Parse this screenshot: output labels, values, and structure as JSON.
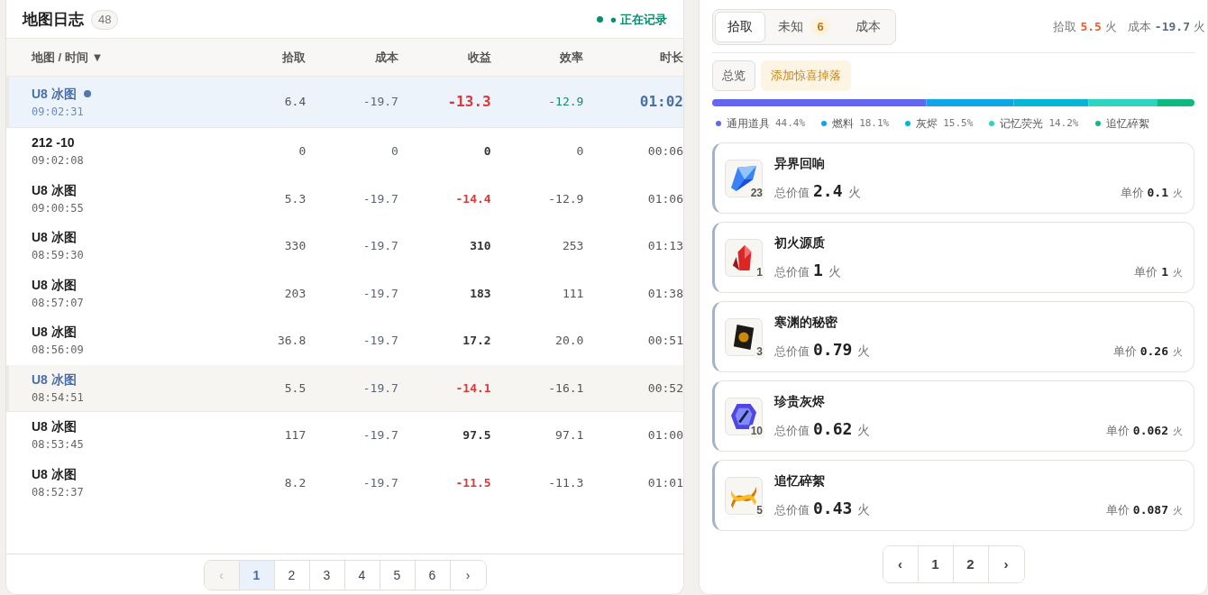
{
  "log": {
    "title": "地图日志",
    "count": "48",
    "status": "● 正在记录",
    "columns": [
      "地图 / 时间 ▼",
      "拾取",
      "成本",
      "收益",
      "效率",
      "时长"
    ],
    "rows": [
      {
        "map": "U8 冰图",
        "time": "09:02:31",
        "pickup": "6.4",
        "cost": "-19.7",
        "profit": "-13.3",
        "efficiency": "-12.9",
        "duration": "01:02",
        "selected": true,
        "highlighted": false,
        "live": true,
        "loss": true
      },
      {
        "map": "212 -10",
        "time": "09:02:08",
        "pickup": "0",
        "cost": "0",
        "profit": "0",
        "efficiency": "0",
        "duration": "00:06",
        "selected": false,
        "highlighted": false,
        "live": false,
        "loss": false
      },
      {
        "map": "U8 冰图",
        "time": "09:00:55",
        "pickup": "5.3",
        "cost": "-19.7",
        "profit": "-14.4",
        "efficiency": "-12.9",
        "duration": "01:06",
        "selected": false,
        "highlighted": false,
        "live": false,
        "loss": true
      },
      {
        "map": "U8 冰图",
        "time": "08:59:30",
        "pickup": "330",
        "cost": "-19.7",
        "profit": "310",
        "efficiency": "253",
        "duration": "01:13",
        "selected": false,
        "highlighted": false,
        "live": false,
        "loss": false
      },
      {
        "map": "U8 冰图",
        "time": "08:57:07",
        "pickup": "203",
        "cost": "-19.7",
        "profit": "183",
        "efficiency": "111",
        "duration": "01:38",
        "selected": false,
        "highlighted": false,
        "live": false,
        "loss": false
      },
      {
        "map": "U8 冰图",
        "time": "08:56:09",
        "pickup": "36.8",
        "cost": "-19.7",
        "profit": "17.2",
        "efficiency": "20.0",
        "duration": "00:51",
        "selected": false,
        "highlighted": false,
        "live": false,
        "loss": false
      },
      {
        "map": "U8 冰图",
        "time": "08:54:51",
        "pickup": "5.5",
        "cost": "-19.7",
        "profit": "-14.1",
        "efficiency": "-16.1",
        "duration": "00:52",
        "selected": false,
        "highlighted": true,
        "live": false,
        "loss": true
      },
      {
        "map": "U8 冰图",
        "time": "08:53:45",
        "pickup": "117",
        "cost": "-19.7",
        "profit": "97.5",
        "efficiency": "97.1",
        "duration": "01:00",
        "selected": false,
        "highlighted": false,
        "live": false,
        "loss": false
      },
      {
        "map": "U8 冰图",
        "time": "08:52:37",
        "pickup": "8.2",
        "cost": "-19.7",
        "profit": "-11.5",
        "efficiency": "-11.3",
        "duration": "01:01",
        "selected": false,
        "highlighted": false,
        "live": false,
        "loss": true
      }
    ],
    "pages": [
      {
        "label": "‹",
        "selected": false,
        "disabled": true
      },
      {
        "label": "1",
        "selected": true,
        "disabled": false
      },
      {
        "label": "2",
        "selected": false,
        "disabled": false
      },
      {
        "label": "3",
        "selected": false,
        "disabled": false
      },
      {
        "label": "4",
        "selected": false,
        "disabled": false
      },
      {
        "label": "5",
        "selected": false,
        "disabled": false
      },
      {
        "label": "6",
        "selected": false,
        "disabled": false
      },
      {
        "label": "›",
        "selected": false,
        "disabled": false
      }
    ]
  },
  "detail": {
    "tabs": [
      {
        "label": "拾取",
        "selected": true
      },
      {
        "label": "未知",
        "badge": "6",
        "selected": false
      },
      {
        "label": "成本",
        "selected": false
      }
    ],
    "summary": {
      "pickup_label": "拾取",
      "pickup": "5.5",
      "pickup_unit": "火",
      "cost_label": "成本",
      "cost": "-19.7",
      "cost_unit": "火"
    },
    "filters": [
      {
        "label": "总览",
        "kind": "plain"
      },
      {
        "label": "添加惊喜掉落",
        "kind": "accent"
      }
    ],
    "categories": [
      {
        "name": "通用道具",
        "percent": "44.4%",
        "color": "#6366f1"
      },
      {
        "name": "燃料",
        "percent": "18.1%",
        "color": "#0ea5e9"
      },
      {
        "name": "灰烬",
        "percent": "15.5%",
        "color": "#06b6d4"
      },
      {
        "name": "记忆荧光",
        "percent": "14.2%",
        "color": "#2dd4bf"
      },
      {
        "name": "追忆碎絮",
        "color": "#10b981"
      }
    ],
    "items": [
      {
        "name": "异界回响",
        "count": "23",
        "total_label": "总价值",
        "total": "2.4",
        "unit_label": "单价",
        "unit_price": "0.1",
        "currency": "火",
        "unit_currency": "火",
        "kind": "blue-crystal"
      },
      {
        "name": "初火源质",
        "count": "1",
        "total_label": "总价值",
        "total": "1",
        "unit_label": "单价",
        "unit_price": "1",
        "currency": "火",
        "unit_currency": "火",
        "kind": "red-crystal"
      },
      {
        "name": "寒渊的秘密",
        "count": "3",
        "total_label": "总价值",
        "total": "0.79",
        "unit_label": "单价",
        "unit_price": "0.26",
        "currency": "火",
        "unit_currency": "火",
        "kind": "card"
      },
      {
        "name": "珍贵灰烬",
        "count": "10",
        "total_label": "总价值",
        "total": "0.62",
        "unit_label": "单价",
        "unit_price": "0.062",
        "currency": "火",
        "unit_currency": "火",
        "kind": "gem"
      },
      {
        "name": "追忆碎絮",
        "count": "5",
        "total_label": "总价值",
        "total": "0.43",
        "unit_label": "单价",
        "unit_price": "0.087",
        "currency": "火",
        "unit_currency": "火",
        "kind": "ribbon"
      }
    ],
    "pages": [
      {
        "label": "‹",
        "selected": false
      },
      {
        "label": "1",
        "selected": false
      },
      {
        "label": "2",
        "selected": false
      },
      {
        "label": "›",
        "selected": false
      }
    ]
  }
}
